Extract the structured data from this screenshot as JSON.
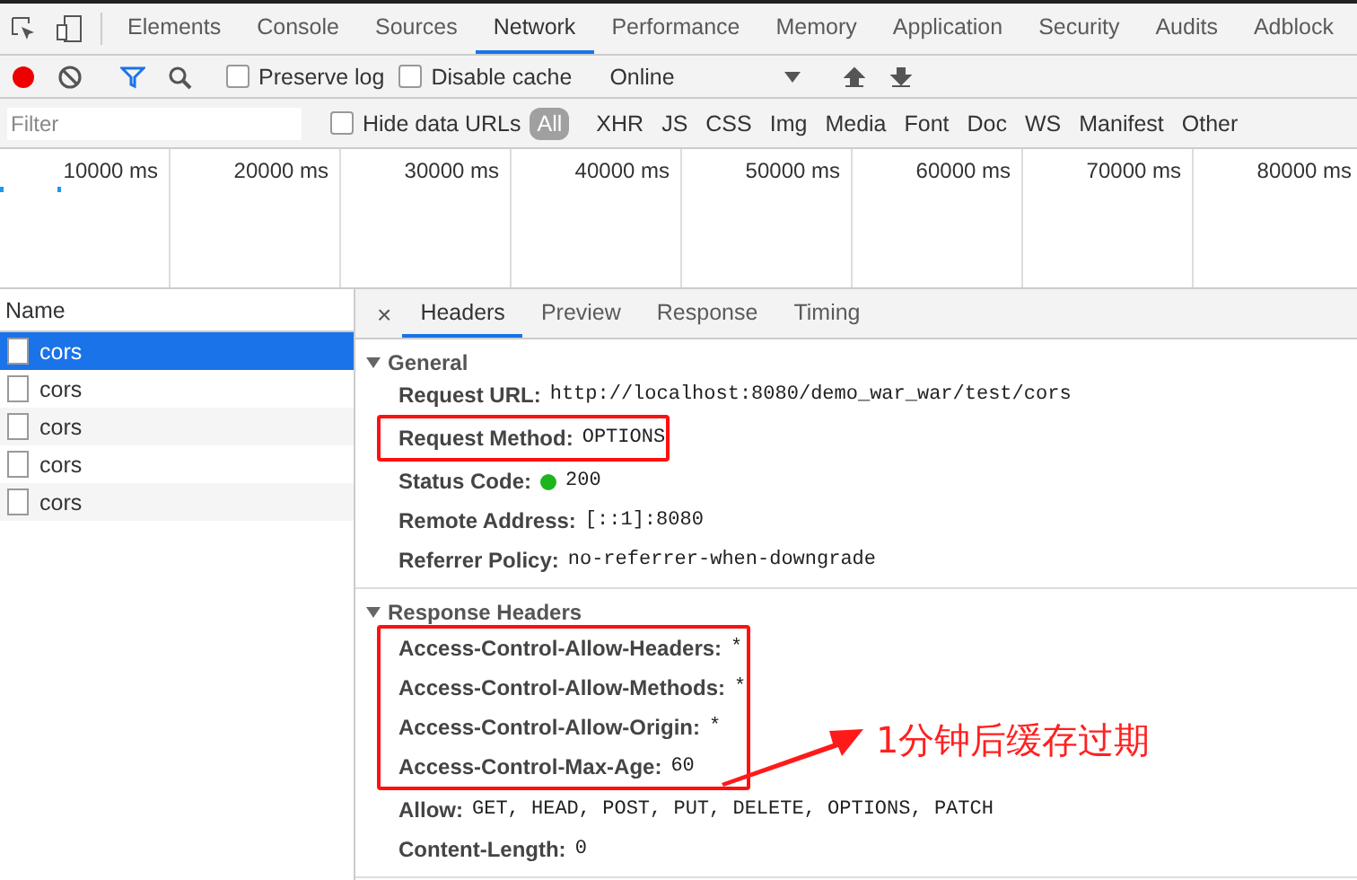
{
  "main_tabs": [
    {
      "label": "Elements",
      "selected": false
    },
    {
      "label": "Console",
      "selected": false
    },
    {
      "label": "Sources",
      "selected": false
    },
    {
      "label": "Network",
      "selected": true
    },
    {
      "label": "Performance",
      "selected": false
    },
    {
      "label": "Memory",
      "selected": false
    },
    {
      "label": "Application",
      "selected": false
    },
    {
      "label": "Security",
      "selected": false
    },
    {
      "label": "Audits",
      "selected": false
    },
    {
      "label": "Adblock",
      "selected": false
    }
  ],
  "toolbar": {
    "recording": true,
    "preserve_log": {
      "label": "Preserve log",
      "checked": false
    },
    "disable_cache": {
      "label": "Disable cache",
      "checked": false
    },
    "throttling": "Online"
  },
  "filter_bar": {
    "placeholder": "Filter",
    "hide_data_urls": {
      "label": "Hide data URLs",
      "checked": false
    },
    "types": [
      {
        "label": "All",
        "selected": true
      },
      {
        "label": "XHR",
        "selected": false
      },
      {
        "label": "JS",
        "selected": false
      },
      {
        "label": "CSS",
        "selected": false
      },
      {
        "label": "Img",
        "selected": false
      },
      {
        "label": "Media",
        "selected": false
      },
      {
        "label": "Font",
        "selected": false
      },
      {
        "label": "Doc",
        "selected": false
      },
      {
        "label": "WS",
        "selected": false
      },
      {
        "label": "Manifest",
        "selected": false
      },
      {
        "label": "Other",
        "selected": false
      }
    ]
  },
  "timeline": {
    "ticks": [
      "10000 ms",
      "20000 ms",
      "30000 ms",
      "40000 ms",
      "50000 ms",
      "60000 ms",
      "70000 ms",
      "80000 ms"
    ]
  },
  "requests": {
    "column": "Name",
    "rows": [
      {
        "name": "cors",
        "selected": true
      },
      {
        "name": "cors",
        "selected": false
      },
      {
        "name": "cors",
        "selected": false
      },
      {
        "name": "cors",
        "selected": false
      },
      {
        "name": "cors",
        "selected": false
      }
    ]
  },
  "detail_tabs": {
    "close": "×",
    "tabs": [
      {
        "label": "Headers",
        "selected": true
      },
      {
        "label": "Preview",
        "selected": false
      },
      {
        "label": "Response",
        "selected": false
      },
      {
        "label": "Timing",
        "selected": false
      }
    ]
  },
  "sections": [
    {
      "title": "General",
      "expanded": true,
      "rows": [
        {
          "key": "Request URL:",
          "value": "http://localhost:8080/demo_war_war/test/cors",
          "highlighted": false
        },
        {
          "key": "Request Method:",
          "value": "OPTIONS",
          "highlighted": true
        },
        {
          "key": "Status Code:",
          "value": "200",
          "kind": "status",
          "highlighted": false
        },
        {
          "key": "Remote Address:",
          "value": "[::1]:8080",
          "highlighted": false
        },
        {
          "key": "Referrer Policy:",
          "value": "no-referrer-when-downgrade",
          "highlighted": false
        }
      ]
    },
    {
      "title": "Response Headers",
      "expanded": true,
      "highlighted_rows": [
        {
          "key": "Access-Control-Allow-Headers:",
          "value": "*"
        },
        {
          "key": "Access-Control-Allow-Methods:",
          "value": "*"
        },
        {
          "key": "Access-Control-Allow-Origin:",
          "value": "*"
        },
        {
          "key": "Access-Control-Max-Age:",
          "value": "60"
        }
      ],
      "rows": [
        {
          "key": "Allow:",
          "value": "GET, HEAD, POST, PUT, DELETE, OPTIONS, PATCH",
          "highlighted": false
        },
        {
          "key": "Content-Length:",
          "value": "0",
          "highlighted": false
        }
      ]
    }
  ],
  "annotation": {
    "note": "1分钟后缓存过期"
  }
}
